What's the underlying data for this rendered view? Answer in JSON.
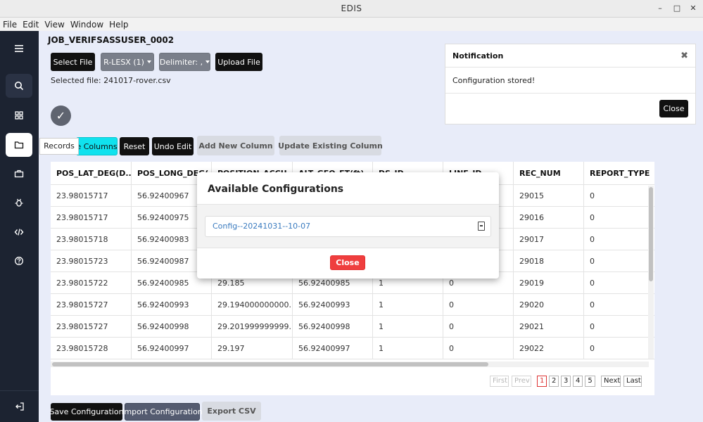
{
  "window": {
    "title": "EDIS",
    "controls": {
      "minimize": "–",
      "maximize": "□",
      "close": "✕"
    }
  },
  "menu": [
    "File",
    "Edit",
    "View",
    "Window",
    "Help"
  ],
  "sidebar": {
    "items": [
      {
        "icon": "hamburger-menu-icon"
      },
      {
        "icon": "search-icon"
      },
      {
        "icon": "grid-icon"
      },
      {
        "icon": "folder-icon",
        "active": true
      },
      {
        "icon": "briefcase-icon"
      },
      {
        "icon": "bug-icon"
      },
      {
        "icon": "code-icon"
      },
      {
        "icon": "help-icon"
      }
    ],
    "logout_icon": "logout-icon",
    "tooltip": "Records"
  },
  "job": {
    "title": "JOB_VERIFSASSUSER_0002",
    "select_file": "Select File",
    "format_dropdown": "R-LESX (1)",
    "delimiter_dropdown": "Delimiter: ,",
    "upload_file": "Upload File",
    "selected_file": "Selected file: 241017-rover.csv",
    "check_mark": "✓"
  },
  "toolbar": {
    "choose_columns": "e Columns",
    "reset": "Reset",
    "undo_edit": "Undo Edit",
    "add_new_column": "Add New Column",
    "update_existing_column": "Update Existing Column"
  },
  "table": {
    "columns": [
      "POS_LAT_DEG(D...",
      "POS_LONG_DEG(",
      "POSITION_ACCU",
      "ALT_GEO_FT(ft)",
      "DS_ID",
      "LINE_ID",
      "REC_NUM",
      "REPORT_TYPE"
    ],
    "rows": [
      [
        "23.98015717",
        "56.92400967",
        "",
        "",
        "",
        "",
        "29015",
        "0"
      ],
      [
        "23.98015717",
        "56.92400975",
        "",
        "",
        "",
        "",
        "29016",
        "0"
      ],
      [
        "23.98015718",
        "56.92400983",
        "",
        "",
        "",
        "",
        "29017",
        "0"
      ],
      [
        "23.98015723",
        "56.92400987",
        "",
        "",
        "",
        "",
        "29018",
        "0"
      ],
      [
        "23.98015722",
        "56.92400985",
        "29.185",
        "56.92400985",
        "1",
        "0",
        "29019",
        "0"
      ],
      [
        "23.98015727",
        "56.92400993",
        "29.194000000000...",
        "56.92400993",
        "1",
        "0",
        "29020",
        "0"
      ],
      [
        "23.98015727",
        "56.92400998",
        "29.201999999999...",
        "56.92400998",
        "1",
        "0",
        "29021",
        "0"
      ],
      [
        "23.98015728",
        "56.92400997",
        "29.197",
        "56.92400997",
        "1",
        "0",
        "29022",
        "0"
      ]
    ]
  },
  "pagination": {
    "first": "First",
    "prev": "Prev",
    "pages": [
      "1",
      "2",
      "3",
      "4",
      "5"
    ],
    "current": "1",
    "next": "Next",
    "last": "Last"
  },
  "footer": {
    "save_configuration": "Save Configuration",
    "import_configuration": "Import Configuration",
    "export_csv": "Export CSV"
  },
  "notification": {
    "title": "Notification",
    "close_x": "✖",
    "message": "Configuration stored!",
    "close": "Close"
  },
  "config_modal": {
    "title": "Available Configurations",
    "items": [
      "Config--20241031--10-07"
    ],
    "close": "Close"
  },
  "colors": {
    "sidebar": "#1c2331",
    "accent_cyan": "#10e2ee",
    "danger": "#ef3e3e",
    "link": "#3a7bbf"
  }
}
